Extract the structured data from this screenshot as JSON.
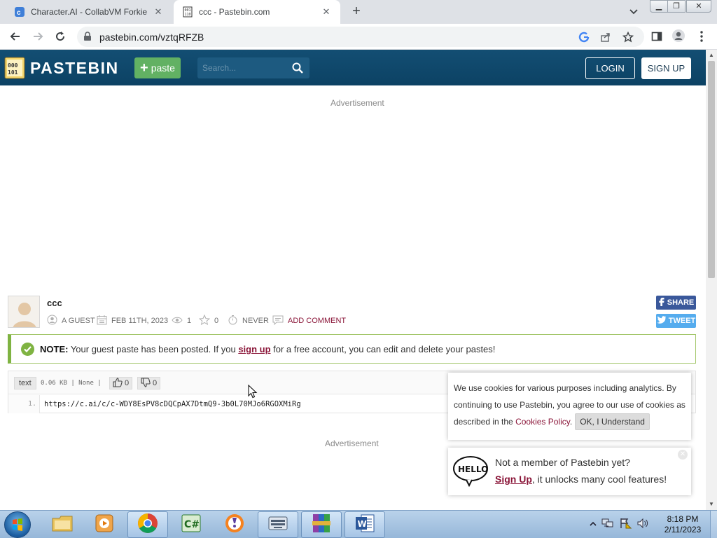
{
  "browser": {
    "tabs": [
      {
        "title": "Character.AI - CollabVM Forkie",
        "active": false,
        "favicon": "character-ai-icon"
      },
      {
        "title": "ccc - Pastebin.com",
        "active": true,
        "favicon": "pastebin-icon"
      }
    ],
    "new_tab": "+",
    "window_controls": [
      "minimize-icon",
      "restore-icon",
      "close-icon"
    ],
    "url": "pastebin.com/vztqRFZB"
  },
  "header": {
    "logo_text": "PASTEBIN",
    "paste_button": "paste",
    "search_placeholder": "Search...",
    "login": "LOGIN",
    "signup": "SIGN UP",
    "color": "#0e4a6e"
  },
  "ads": {
    "top": "Advertisement",
    "bottom": "Advertisement"
  },
  "paste": {
    "title": "ccc",
    "author": "A GUEST",
    "date": "FEB 11TH, 2023",
    "views": "1",
    "stars": "0",
    "expires": "NEVER",
    "add_comment": "ADD COMMENT",
    "syntax": "text",
    "info": "0.06 KB | None |",
    "likes": "0",
    "dislikes": "0",
    "lines": [
      {
        "num": "1.",
        "code": "https://c.ai/c/c-WDY8EsPV8cDQCpAX7DtmQ9-3b0L70MJo6RGOXMiRg"
      }
    ]
  },
  "share": {
    "facebook": "SHARE",
    "twitter": "TWEET"
  },
  "notice": {
    "label": "NOTE:",
    "before": " Your guest paste has been posted. If you ",
    "link": "sign up",
    "after": " for a free account, you can edit and delete your pastes!"
  },
  "cookie": {
    "text": "We use cookies for various purposes including analytics. By continuing to use Pastebin, you agree to our use of cookies as described in the ",
    "link": "Cookies Policy",
    "end": ".",
    "button": "OK, I Understand"
  },
  "hello_popup": {
    "line1": "Not a member of Pastebin yet?",
    "link": "Sign Up",
    "line2_rest": ", it unlocks many cool features!"
  },
  "taskbar": {
    "apps": [
      "file-explorer-icon",
      "media-player-icon",
      "chrome-icon",
      "csharp-icon",
      "avast-icon",
      "keyboard-icon",
      "winrar-icon",
      "word-icon"
    ],
    "time": "8:18 PM",
    "date": "2/11/2023"
  }
}
